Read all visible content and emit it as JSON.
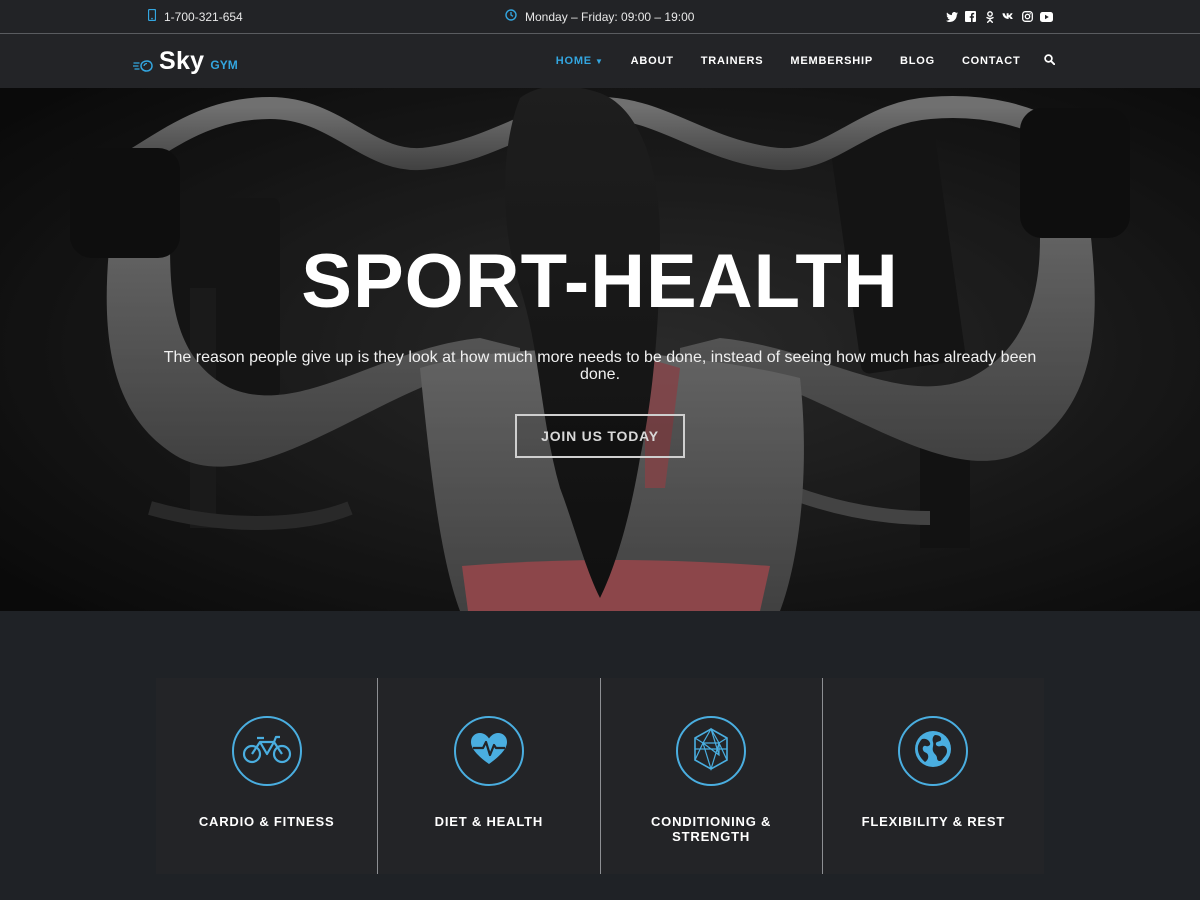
{
  "topbar": {
    "phone": "1-700-321-654",
    "hours": "Monday – Friday: 09:00 – 19:00",
    "social": [
      "twitter-icon",
      "facebook-icon",
      "odnoklassniki-icon",
      "vk-icon",
      "instagram-icon",
      "youtube-icon"
    ]
  },
  "brand": {
    "name": "Sky",
    "tag": "GYM",
    "accent": "#33a6e0"
  },
  "nav": {
    "items": [
      "HOME",
      "ABOUT",
      "TRAINERS",
      "MEMBERSHIP",
      "BLOG",
      "CONTACT"
    ],
    "active": "HOME"
  },
  "hero": {
    "title": "SPORT-HEALTH",
    "subtitle": "The reason people give up is they look at how much more needs to be done, instead of seeing how much has already been done.",
    "button": "JOIN US TODAY"
  },
  "features": [
    {
      "label": "CARDIO & FITNESS",
      "icon": "bicycle-icon"
    },
    {
      "label": "DIET & HEALTH",
      "icon": "heart-pulse-icon"
    },
    {
      "label": "CONDITIONING & STRENGTH",
      "icon": "polyhedron-icon"
    },
    {
      "label": "FLEXIBILITY & REST",
      "icon": "globe-icon"
    }
  ]
}
